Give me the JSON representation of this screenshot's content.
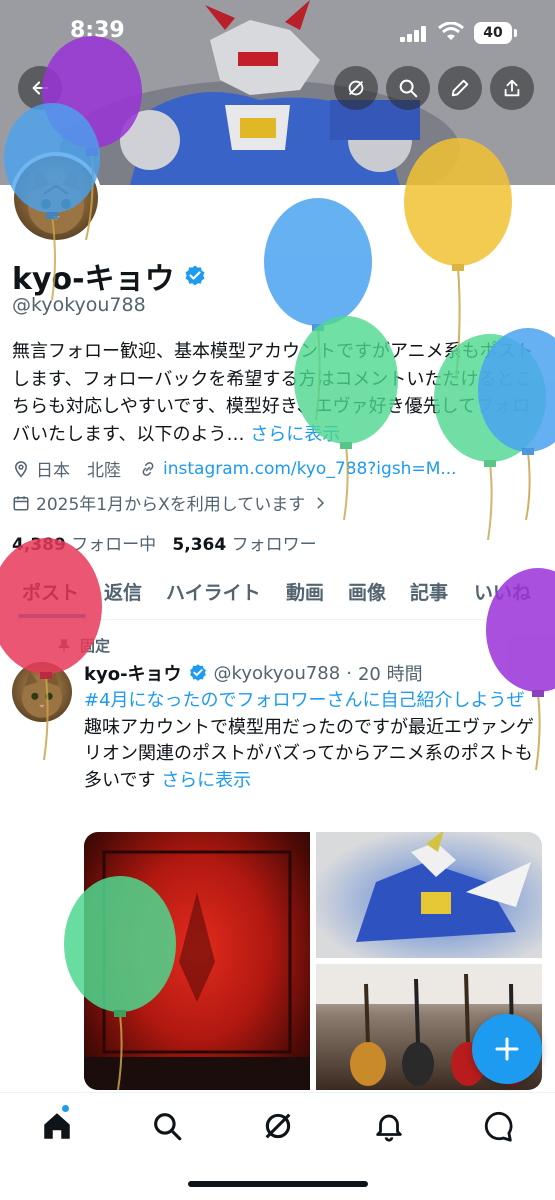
{
  "status_bar": {
    "time": "8:39",
    "battery": "40"
  },
  "profile": {
    "name": "kyo-キョウ",
    "handle": "@kyokyou788",
    "bio_text": "無言フォロー歓迎、基本模型アカウントですがアニメ系もポストします、フォローバックを希望する方はコメントいただけるとこちらも対応しやすいです、模型好き、エヴァ好き優先してフォロバいたします、以下のよう… ",
    "bio_more": "さらに表示",
    "location": "日本　北陸",
    "link": "instagram.com/kyo_788?igsh=M...",
    "joined": "2025年1月からXを利用しています",
    "following_count": "4,389",
    "following_label": "フォロー中",
    "followers_count": "5,364",
    "followers_label": "フォロワー"
  },
  "tabs": [
    {
      "label": "ポスト"
    },
    {
      "label": "返信"
    },
    {
      "label": "ハイライト"
    },
    {
      "label": "動画"
    },
    {
      "label": "画像"
    },
    {
      "label": "記事"
    },
    {
      "label": "いいね"
    }
  ],
  "post": {
    "pinned_label": "固定",
    "author_name": "kyo-キョウ",
    "author_handle": "@kyokyou788",
    "time": "20 時間",
    "hashtag": "#4月になったのでフォロワーさんに自己紹介しようぜ",
    "text": "趣味アカウントで模型用だったのですが最近エヴァンゲリオン関連のポストがバズってからアニメ系のポストも多いです ",
    "more": "さらに表示"
  },
  "icons": {
    "back": "back-arrow-icon",
    "grok": "grok-icon",
    "search": "search-icon",
    "edit": "pencil-icon",
    "share": "share-icon",
    "compose": "plus-icon"
  }
}
